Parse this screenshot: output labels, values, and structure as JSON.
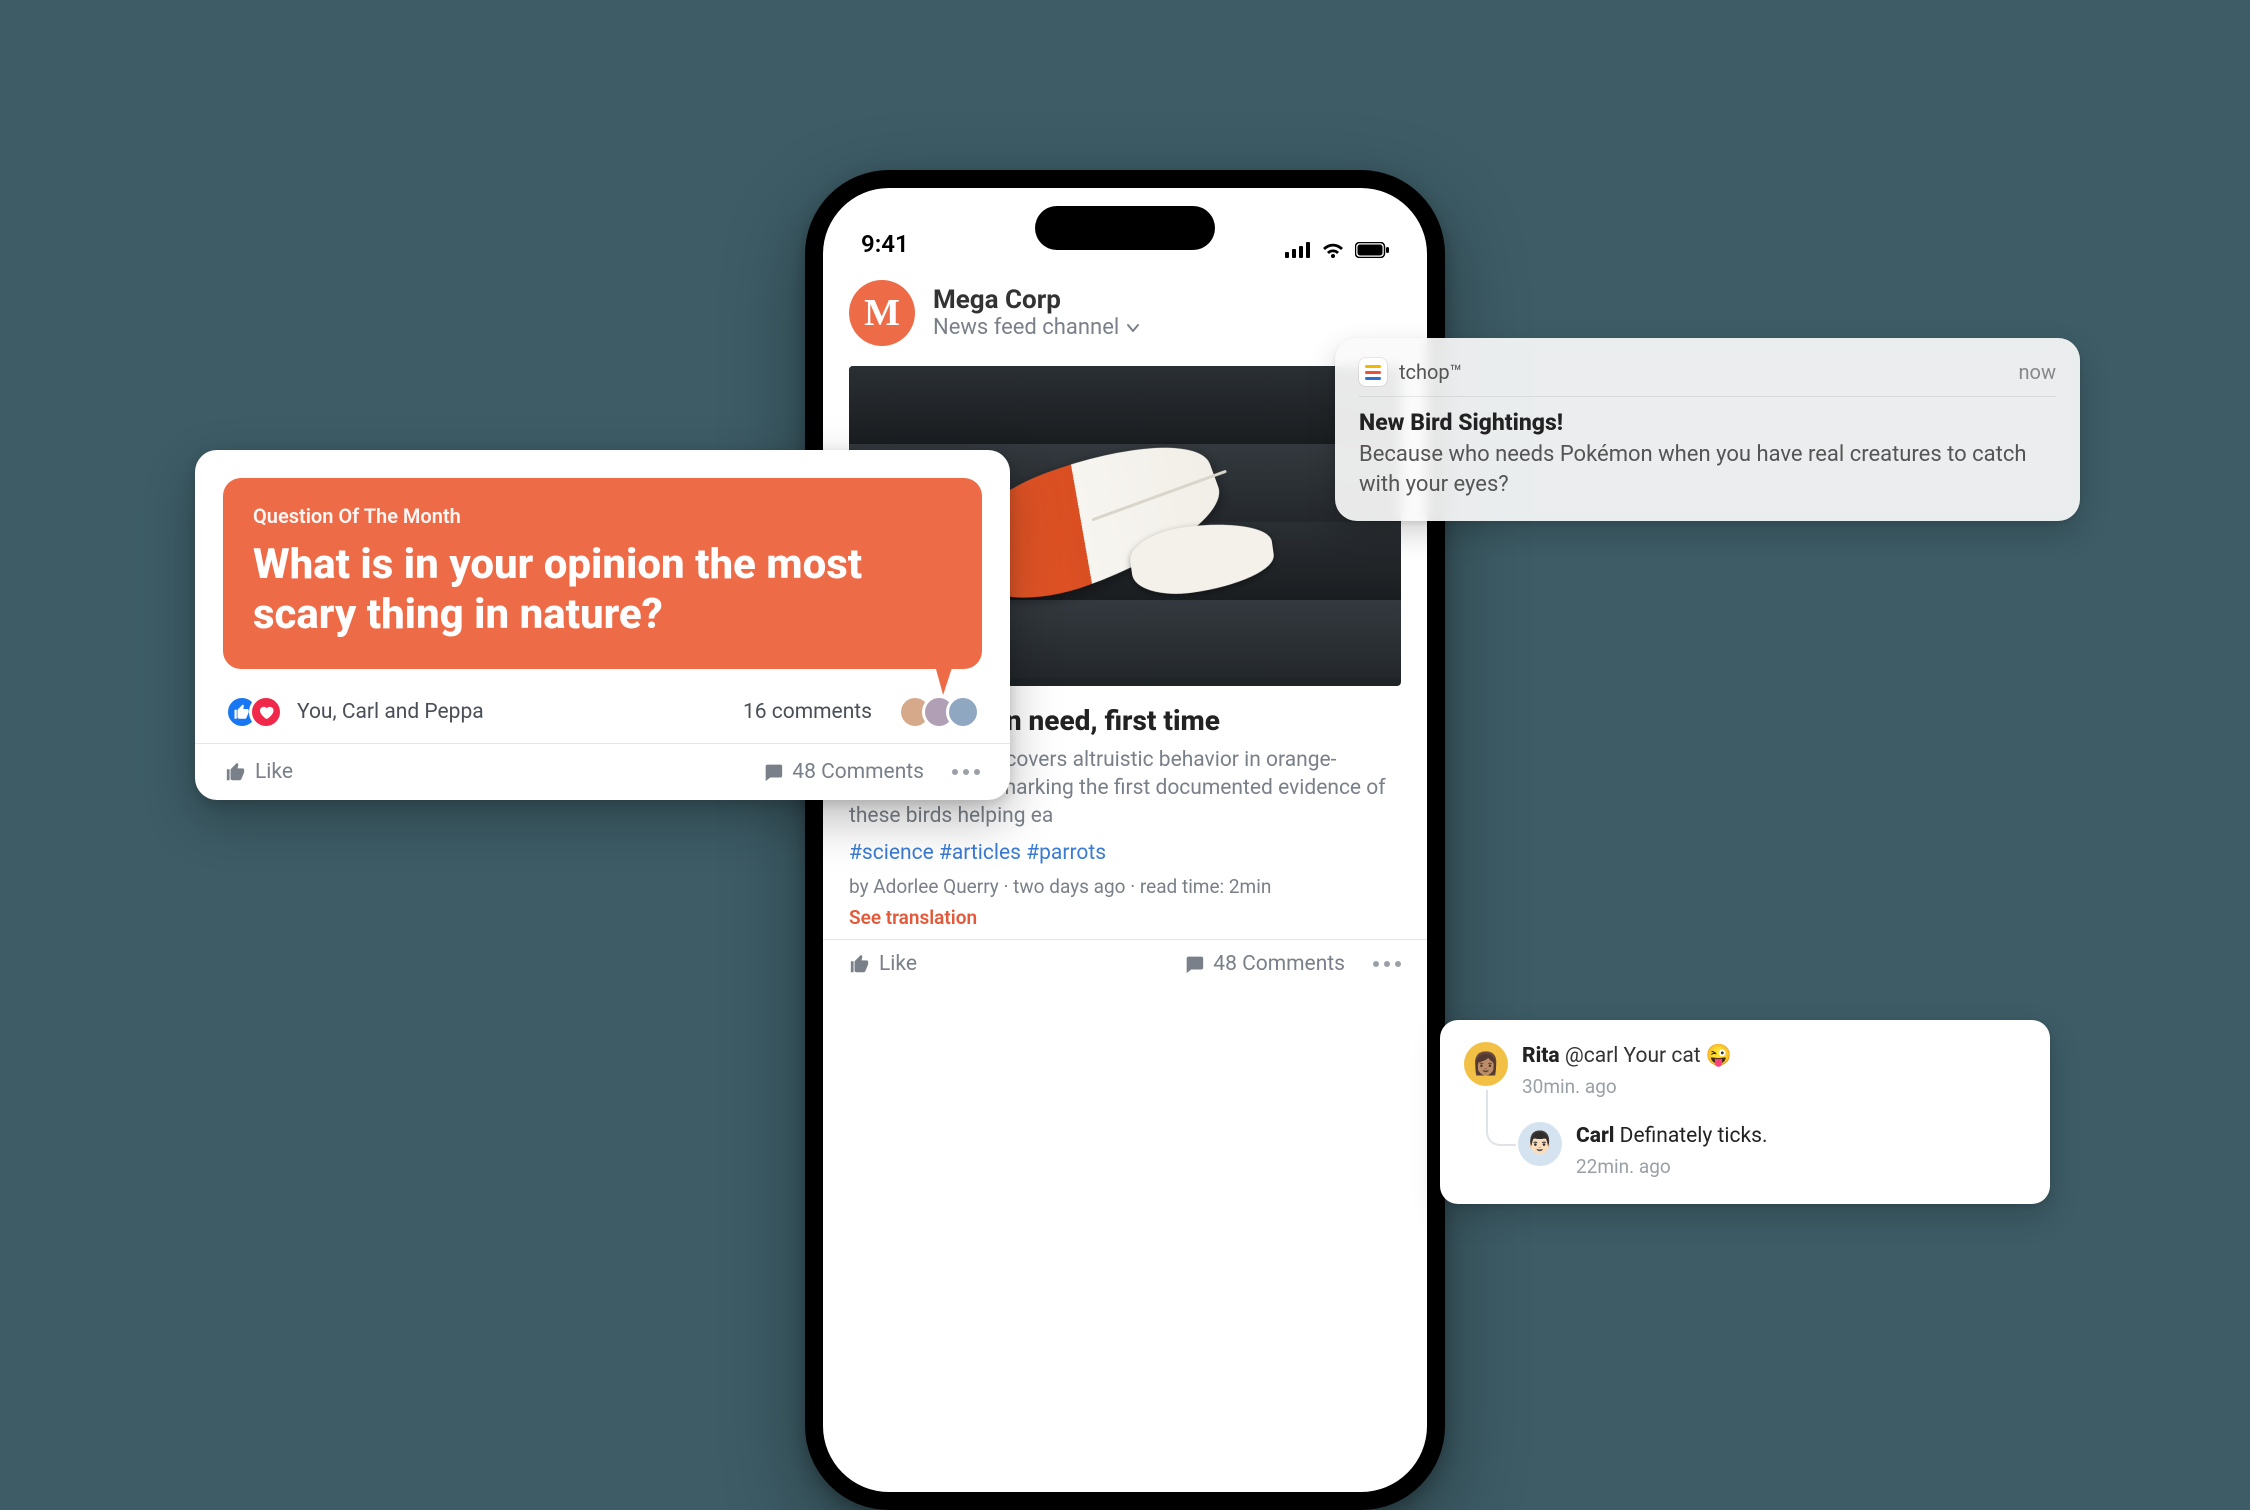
{
  "colors": {
    "accent": "#ee6b47",
    "link": "#3a7bd5"
  },
  "status": {
    "time": "9:41"
  },
  "feed": {
    "brand_initial": "M",
    "brand_name": "Mega Corp",
    "channel_label": "News feed channel"
  },
  "article": {
    "title": "help others in need, first time",
    "body": "New research uncovers altruistic behavior in orange-winged parrots, marking the first documented evidence of these birds helping ea",
    "tags": "#science #articles #parrots",
    "byline": "by Adorlee Querry · two days ago · read time: 2min",
    "see_translation": "See translation"
  },
  "actions": {
    "like_label": "Like",
    "comments_label": "48 Comments"
  },
  "question_card": {
    "kicker": "Question Of The Month",
    "question": "What is in your opinion the most scary thing in nature?",
    "who": "You, Carl and Peppa",
    "comments_count": "16 comments",
    "like_label": "Like",
    "bar_comments_label": "48 Comments"
  },
  "push": {
    "app_name": "tchop™",
    "time": "now",
    "title": "New Bird Sightings!",
    "body": "Because who needs Pokémon when you have real creatures to catch with your eyes?"
  },
  "comments": [
    {
      "name": "Rita",
      "text": "@carl Your cat 😜",
      "meta": "30min. ago"
    },
    {
      "name": "Carl",
      "text": "Definately ticks.",
      "meta": "22min. ago"
    }
  ]
}
